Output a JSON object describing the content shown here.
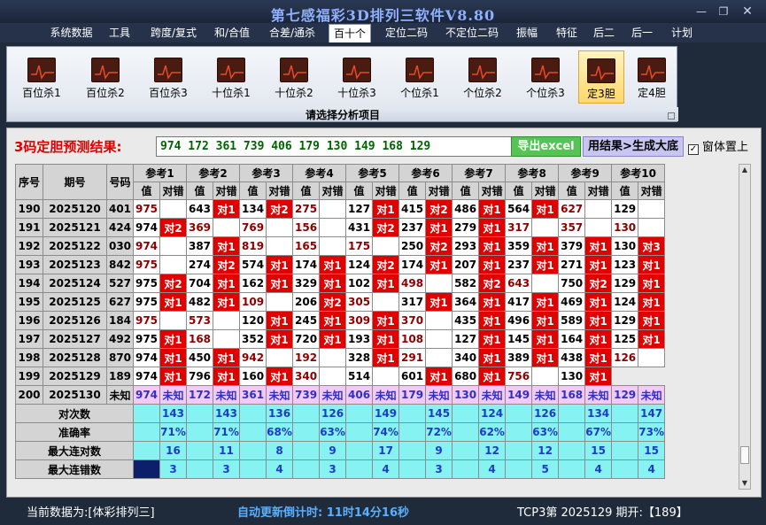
{
  "window": {
    "title": "第七感福彩3D排列三软件V8.80"
  },
  "menu": [
    "系统数据",
    "工具",
    "跨度/复式",
    "和/合值",
    "合差/通杀",
    "百十个",
    "定位二码",
    "不定位二码",
    "振幅",
    "特征",
    "后二",
    "后一",
    "计划"
  ],
  "menu_active_index": 5,
  "ribbon": {
    "buttons": [
      "百位杀1",
      "百位杀2",
      "百位杀3",
      "十位杀1",
      "十位杀2",
      "十位杀3",
      "个位杀1",
      "个位杀2",
      "个位杀3",
      "定3胆",
      "定4胆"
    ],
    "selected_index": 9,
    "caption": "请选择分析项目"
  },
  "prediction": {
    "label": "3码定胆预测结果:",
    "value": "974 172 361 739 406 179 130 149 168 129",
    "excel_button": "导出excel",
    "generate_button": "用结果>生成大底",
    "topmost_label": "窗体置上",
    "topmost_checked": true
  },
  "table": {
    "col_seq": "序号",
    "col_period": "期号",
    "col_code": "号码",
    "ref_headers": [
      "参考1",
      "参考2",
      "参考3",
      "参考4",
      "参考5",
      "参考6",
      "参考7",
      "参考8",
      "参考9",
      "参考10"
    ],
    "sub_value": "值",
    "sub_check": "对错",
    "rows": [
      {
        "seq": "190",
        "period": "2025120",
        "code": "401",
        "vals": [
          "975",
          "643",
          "134",
          "275",
          "127",
          "415",
          "486",
          "564",
          "627",
          "129"
        ],
        "checks": [
          "",
          "对1",
          "对2",
          "",
          "对1",
          "对2",
          "对1",
          "对1",
          "",
          ""
        ],
        "dark": [
          1,
          0,
          0,
          1,
          0,
          0,
          0,
          0,
          1,
          0
        ]
      },
      {
        "seq": "191",
        "period": "2025121",
        "code": "424",
        "vals": [
          "974",
          "369",
          "769",
          "156",
          "431",
          "237",
          "279",
          "317",
          "357",
          "130"
        ],
        "checks": [
          "对2",
          "",
          "",
          "",
          "对2",
          "对1",
          "对1",
          "",
          "",
          ""
        ],
        "dark": [
          0,
          1,
          1,
          1,
          0,
          0,
          0,
          1,
          1,
          1
        ]
      },
      {
        "seq": "192",
        "period": "2025122",
        "code": "030",
        "vals": [
          "974",
          "387",
          "819",
          "165",
          "175",
          "250",
          "293",
          "359",
          "379",
          "130"
        ],
        "checks": [
          "",
          "对1",
          "",
          "",
          "",
          "对2",
          "对1",
          "对1",
          "对1",
          "对3"
        ],
        "dark": [
          1,
          0,
          1,
          1,
          1,
          0,
          0,
          0,
          0,
          0
        ]
      },
      {
        "seq": "193",
        "period": "2025123",
        "code": "842",
        "vals": [
          "975",
          "274",
          "574",
          "174",
          "124",
          "174",
          "207",
          "237",
          "271",
          "123"
        ],
        "checks": [
          "",
          "对2",
          "对1",
          "对1",
          "对2",
          "对1",
          "对1",
          "对1",
          "对1",
          "对1"
        ],
        "dark": [
          1,
          0,
          0,
          0,
          0,
          0,
          0,
          0,
          0,
          0
        ]
      },
      {
        "seq": "194",
        "period": "2025124",
        "code": "527",
        "vals": [
          "975",
          "704",
          "162",
          "329",
          "102",
          "498",
          "582",
          "643",
          "750",
          "129"
        ],
        "checks": [
          "对2",
          "对1",
          "对1",
          "对1",
          "对1",
          "",
          "对2",
          "",
          "对2",
          "对1"
        ],
        "dark": [
          0,
          0,
          0,
          0,
          0,
          1,
          0,
          1,
          0,
          0
        ]
      },
      {
        "seq": "195",
        "period": "2025125",
        "code": "627",
        "vals": [
          "975",
          "482",
          "109",
          "206",
          "305",
          "317",
          "364",
          "417",
          "469",
          "124"
        ],
        "checks": [
          "对1",
          "对1",
          "",
          "对2",
          "",
          "对1",
          "对1",
          "对1",
          "对1",
          "对1"
        ],
        "dark": [
          0,
          0,
          1,
          0,
          1,
          0,
          0,
          0,
          0,
          0
        ]
      },
      {
        "seq": "196",
        "period": "2025126",
        "code": "184",
        "vals": [
          "975",
          "573",
          "120",
          "245",
          "309",
          "370",
          "435",
          "496",
          "589",
          "129"
        ],
        "checks": [
          "",
          "",
          "对1",
          "对1",
          "对1",
          "",
          "对1",
          "对1",
          "对1",
          "对1"
        ],
        "dark": [
          1,
          1,
          0,
          0,
          1,
          1,
          0,
          0,
          0,
          0
        ]
      },
      {
        "seq": "197",
        "period": "2025127",
        "code": "492",
        "vals": [
          "975",
          "168",
          "352",
          "720",
          "193",
          "108",
          "127",
          "145",
          "164",
          "125"
        ],
        "checks": [
          "对1",
          "",
          "对1",
          "对1",
          "对1",
          "",
          "对1",
          "对1",
          "对1",
          "对1"
        ],
        "dark": [
          0,
          1,
          0,
          0,
          0,
          1,
          0,
          0,
          0,
          0
        ]
      },
      {
        "seq": "198",
        "period": "2025128",
        "code": "870",
        "vals": [
          "974",
          "450",
          "942",
          "192",
          "328",
          "291",
          "340",
          "389",
          "438",
          "126"
        ],
        "checks": [
          "对1",
          "对1",
          "",
          "",
          "对1",
          "",
          "对1",
          "对1",
          "对1",
          ""
        ],
        "dark": [
          0,
          0,
          1,
          1,
          0,
          1,
          0,
          0,
          0,
          1
        ]
      },
      {
        "seq": "199",
        "period": "2025129",
        "code": "189",
        "vals": [
          "974",
          "796",
          "160",
          "340",
          "514",
          "601",
          "680",
          "756",
          "130"
        ],
        "checks": [
          "对1",
          "对1",
          "对1",
          "",
          "",
          "对1",
          "对1",
          "",
          "对1"
        ],
        "dark": [
          0,
          0,
          0,
          1,
          0,
          0,
          0,
          1,
          0
        ]
      }
    ],
    "last_row": {
      "seq": "200",
      "period": "2025130",
      "code": "未知",
      "vals": [
        "974",
        "172",
        "361",
        "739",
        "406",
        "179",
        "130",
        "149",
        "168",
        "129"
      ],
      "check": "未知"
    },
    "stats": [
      {
        "label": "对次数",
        "vals": [
          "143",
          "143",
          "136",
          "126",
          "149",
          "145",
          "124",
          "126",
          "134",
          "147"
        ]
      },
      {
        "label": "准确率",
        "vals": [
          "71%",
          "71%",
          "68%",
          "63%",
          "74%",
          "72%",
          "62%",
          "63%",
          "67%",
          "73%"
        ]
      },
      {
        "label": "最大连对数",
        "vals": [
          "16",
          "11",
          "8",
          "9",
          "17",
          "9",
          "12",
          "12",
          "15",
          "15"
        ]
      },
      {
        "label": "最大连错数",
        "vals": [
          "3",
          "3",
          "4",
          "3",
          "4",
          "3",
          "4",
          "5",
          "4",
          "4"
        ]
      }
    ]
  },
  "status": {
    "current_data": "当前数据为:[体彩排列三]",
    "countdown": "自动更新倒计时: 11时14分16秒",
    "info": "TCP3第 2025129 期开:【189】"
  },
  "colors": {
    "hit": "#e00000",
    "stats_bg": "#86f2f2",
    "last_row_bg": "#f3c9f7",
    "excel_bg": "#55c455",
    "generate_bg": "#c9c5f2"
  }
}
